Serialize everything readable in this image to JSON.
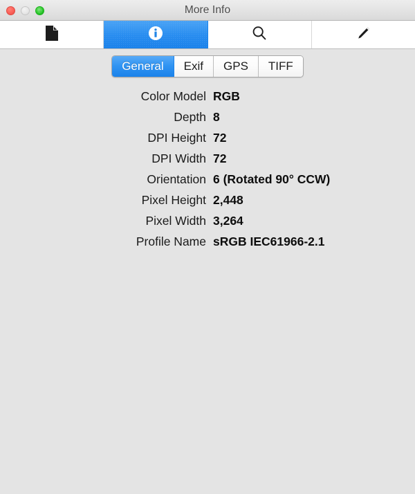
{
  "window": {
    "title": "More Info",
    "traffic_lights": [
      {
        "name": "close",
        "color": "#fb6058"
      },
      {
        "name": "minimize",
        "color": "#e6e6e6"
      },
      {
        "name": "zoom",
        "color": "#2bc92b"
      }
    ]
  },
  "toolbar": {
    "selected_accent": "#2a8ef0",
    "items": [
      {
        "icon": "document-icon",
        "label": "Document",
        "selected": false
      },
      {
        "icon": "info-icon",
        "label": "Info",
        "selected": true
      },
      {
        "icon": "search-icon",
        "label": "Search",
        "selected": false
      },
      {
        "icon": "pencil-icon",
        "label": "Edit",
        "selected": false
      }
    ]
  },
  "tabs": {
    "active_accent": "#2f93f2",
    "items": [
      {
        "label": "General",
        "active": true
      },
      {
        "label": "Exif",
        "active": false
      },
      {
        "label": "GPS",
        "active": false
      },
      {
        "label": "TIFF",
        "active": false
      }
    ]
  },
  "info": {
    "rows": [
      {
        "label": "Color Model",
        "value": "RGB"
      },
      {
        "label": "Depth",
        "value": "8"
      },
      {
        "label": "DPI Height",
        "value": "72"
      },
      {
        "label": "DPI Width",
        "value": "72"
      },
      {
        "label": "Orientation",
        "value": "6 (Rotated 90° CCW)"
      },
      {
        "label": "Pixel Height",
        "value": "2,448"
      },
      {
        "label": "Pixel Width",
        "value": "3,264"
      },
      {
        "label": "Profile Name",
        "value": "sRGB IEC61966-2.1"
      }
    ]
  }
}
